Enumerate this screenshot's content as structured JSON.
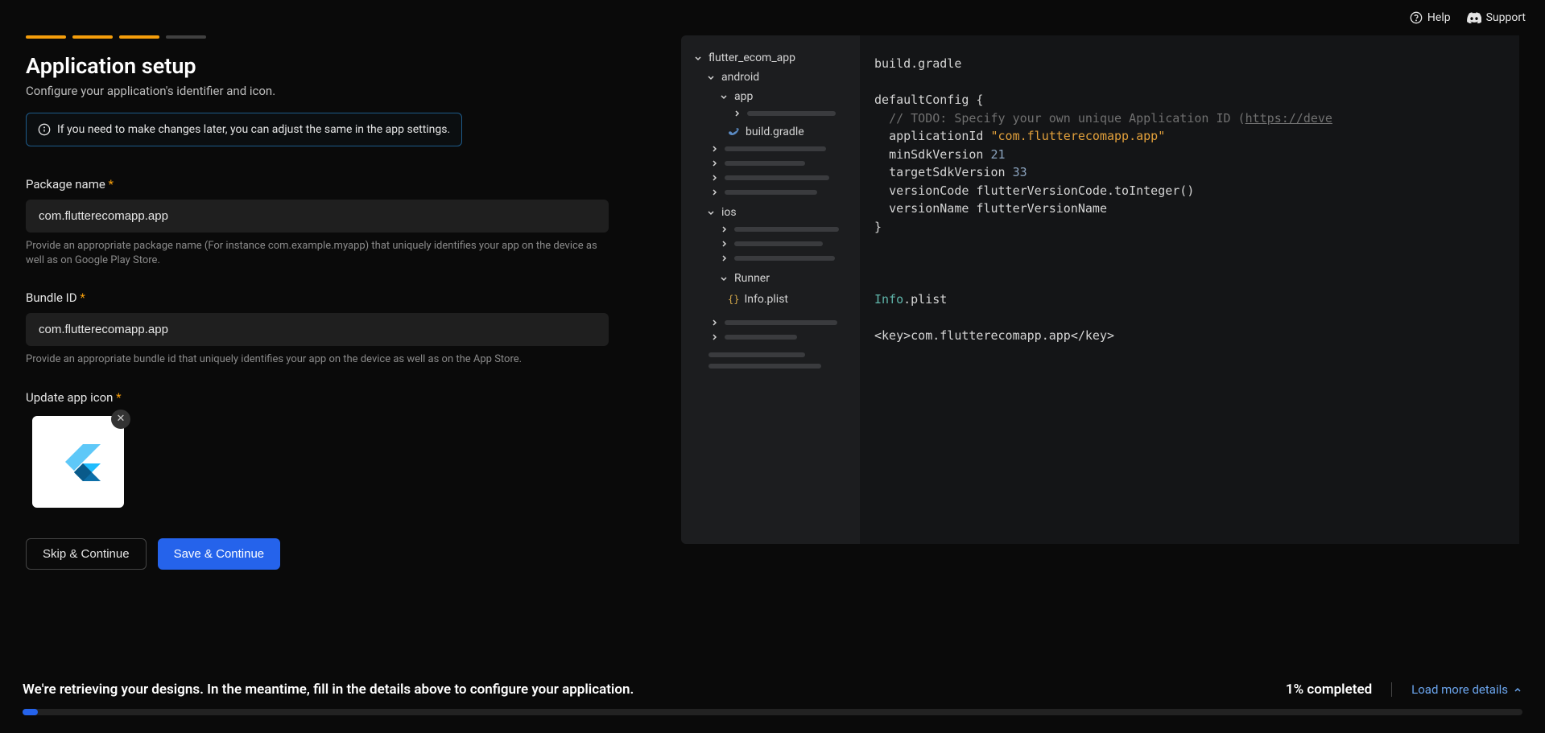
{
  "header": {
    "help_label": "Help",
    "support_label": "Support"
  },
  "progress": {
    "total": 4,
    "active": 3
  },
  "page": {
    "title": "Application setup",
    "subtitle": "Configure your application's identifier and icon.",
    "info": "If you need to make changes later, you can adjust the same in the app settings."
  },
  "form": {
    "package_label": "Package name",
    "package_value": "com.flutterecomapp.app",
    "package_helper": "Provide an appropriate package name (For instance com.example.myapp) that uniquely identifies your app on the device as well as on Google Play Store.",
    "bundle_label": "Bundle ID",
    "bundle_value": "com.flutterecomapp.app",
    "bundle_helper": "Provide an appropriate bundle id that uniquely identifies your app on the device as well as on the App Store.",
    "icon_label": "Update app icon",
    "skip_label": "Skip & Continue",
    "save_label": "Save & Continue"
  },
  "tree": {
    "root": "flutter_ecom_app",
    "android": "android",
    "app": "app",
    "build_gradle": "build.gradle",
    "ios": "ios",
    "runner": "Runner",
    "info_plist": "Info.plist"
  },
  "code": {
    "file1": "build.gradle",
    "l1": "defaultConfig {",
    "l2a": "// TODO: Specify your own unique Application ID (",
    "l2b": "https://deve",
    "l3a": "applicationId",
    "l3b": "\"com.flutterecomapp.app\"",
    "l4a": "minSdkVersion",
    "l4b": "21",
    "l5a": "targetSdkVersion",
    "l5b": "33",
    "l6a": "versionCode",
    "l6b": "flutterVersionCode.toInteger()",
    "l7a": "versionName",
    "l7b": "flutterVersionName",
    "l8": "}",
    "file2a": "Info",
    "file2b": ".plist",
    "l9": "<key>com.flutterecomapp.app</key>"
  },
  "footer": {
    "message": "We're retrieving your designs. In the meantime, fill in the details above to configure your application.",
    "pct_label": "1% completed",
    "pct_value": 1,
    "load_more": "Load more details"
  }
}
